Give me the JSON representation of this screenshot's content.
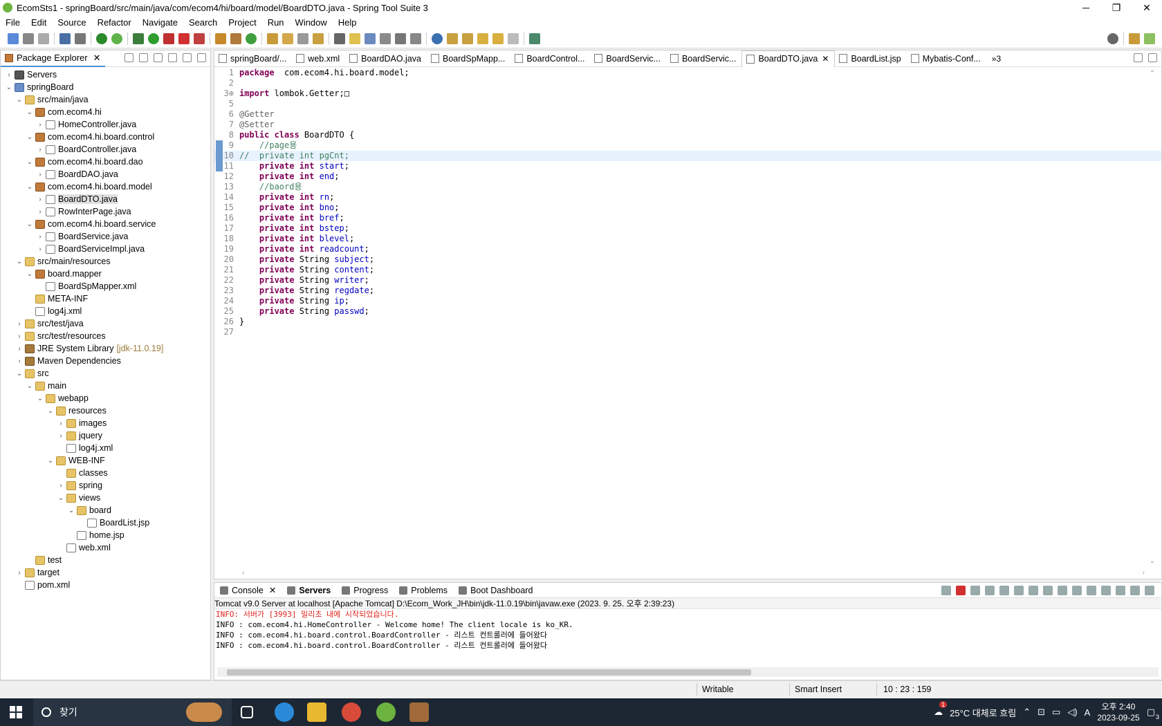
{
  "window": {
    "title": "EcomSts1 - springBoard/src/main/java/com/ecom4/hi/board/model/BoardDTO.java - Spring Tool Suite 3",
    "controls": [
      "─",
      "❐",
      "✕"
    ]
  },
  "menu": [
    "File",
    "Edit",
    "Source",
    "Refactor",
    "Navigate",
    "Search",
    "Project",
    "Run",
    "Window",
    "Help"
  ],
  "package_explorer": {
    "tab_label": "Package Explorer",
    "tree": [
      {
        "label": "Servers",
        "depth": 0,
        "arrow": "›",
        "icon": "server-folder"
      },
      {
        "label": "springBoard",
        "depth": 0,
        "arrow": "⌄",
        "icon": "project"
      },
      {
        "label": "src/main/java",
        "depth": 1,
        "arrow": "⌄",
        "icon": "source-folder"
      },
      {
        "label": "com.ecom4.hi",
        "depth": 2,
        "arrow": "⌄",
        "icon": "package"
      },
      {
        "label": "HomeController.java",
        "depth": 3,
        "arrow": "›",
        "icon": "java-file"
      },
      {
        "label": "com.ecom4.hi.board.control",
        "depth": 2,
        "arrow": "⌄",
        "icon": "package"
      },
      {
        "label": "BoardController.java",
        "depth": 3,
        "arrow": "›",
        "icon": "java-file"
      },
      {
        "label": "com.ecom4.hi.board.dao",
        "depth": 2,
        "arrow": "⌄",
        "icon": "package"
      },
      {
        "label": "BoardDAO.java",
        "depth": 3,
        "arrow": "›",
        "icon": "java-file"
      },
      {
        "label": "com.ecom4.hi.board.model",
        "depth": 2,
        "arrow": "⌄",
        "icon": "package"
      },
      {
        "label": "BoardDTO.java",
        "depth": 3,
        "arrow": "›",
        "icon": "java-file",
        "selected": true
      },
      {
        "label": "RowInterPage.java",
        "depth": 3,
        "arrow": "›",
        "icon": "java-file"
      },
      {
        "label": "com.ecom4.hi.board.service",
        "depth": 2,
        "arrow": "⌄",
        "icon": "package"
      },
      {
        "label": "BoardService.java",
        "depth": 3,
        "arrow": "›",
        "icon": "java-file"
      },
      {
        "label": "BoardServiceImpl.java",
        "depth": 3,
        "arrow": "›",
        "icon": "java-file"
      },
      {
        "label": "src/main/resources",
        "depth": 1,
        "arrow": "⌄",
        "icon": "source-folder"
      },
      {
        "label": "board.mapper",
        "depth": 2,
        "arrow": "⌄",
        "icon": "package"
      },
      {
        "label": "BoardSpMapper.xml",
        "depth": 3,
        "arrow": "",
        "icon": "xml-file"
      },
      {
        "label": "META-INF",
        "depth": 2,
        "arrow": "",
        "icon": "folder"
      },
      {
        "label": "log4j.xml",
        "depth": 2,
        "arrow": "",
        "icon": "xml-file"
      },
      {
        "label": "src/test/java",
        "depth": 1,
        "arrow": "›",
        "icon": "source-folder"
      },
      {
        "label": "src/test/resources",
        "depth": 1,
        "arrow": "›",
        "icon": "source-folder"
      },
      {
        "label": "JRE System Library",
        "depth": 1,
        "arrow": "›",
        "icon": "library",
        "suffix": "[jdk-11.0.19]"
      },
      {
        "label": "Maven Dependencies",
        "depth": 1,
        "arrow": "›",
        "icon": "library"
      },
      {
        "label": "src",
        "depth": 1,
        "arrow": "⌄",
        "icon": "source-folder"
      },
      {
        "label": "main",
        "depth": 2,
        "arrow": "⌄",
        "icon": "folder"
      },
      {
        "label": "webapp",
        "depth": 3,
        "arrow": "⌄",
        "icon": "folder"
      },
      {
        "label": "resources",
        "depth": 4,
        "arrow": "⌄",
        "icon": "folder"
      },
      {
        "label": "images",
        "depth": 5,
        "arrow": "›",
        "icon": "folder"
      },
      {
        "label": "jquery",
        "depth": 5,
        "arrow": "›",
        "icon": "folder"
      },
      {
        "label": "log4j.xml",
        "depth": 5,
        "arrow": "",
        "icon": "xml-file"
      },
      {
        "label": "WEB-INF",
        "depth": 4,
        "arrow": "⌄",
        "icon": "folder"
      },
      {
        "label": "classes",
        "depth": 5,
        "arrow": "",
        "icon": "folder"
      },
      {
        "label": "spring",
        "depth": 5,
        "arrow": "›",
        "icon": "folder"
      },
      {
        "label": "views",
        "depth": 5,
        "arrow": "⌄",
        "icon": "folder"
      },
      {
        "label": "board",
        "depth": 6,
        "arrow": "⌄",
        "icon": "folder"
      },
      {
        "label": "BoardList.jsp",
        "depth": 7,
        "arrow": "",
        "icon": "java-file"
      },
      {
        "label": "home.jsp",
        "depth": 6,
        "arrow": "",
        "icon": "java-file"
      },
      {
        "label": "web.xml",
        "depth": 5,
        "arrow": "",
        "icon": "xml-file"
      },
      {
        "label": "test",
        "depth": 2,
        "arrow": "",
        "icon": "folder"
      },
      {
        "label": "target",
        "depth": 1,
        "arrow": "›",
        "icon": "folder"
      },
      {
        "label": "pom.xml",
        "depth": 1,
        "arrow": "",
        "icon": "xml-file"
      }
    ]
  },
  "editor": {
    "tabs": [
      {
        "label": "springBoard/..."
      },
      {
        "label": "web.xml"
      },
      {
        "label": "BoardDAO.java"
      },
      {
        "label": "BoardSpMapp..."
      },
      {
        "label": "BoardControl..."
      },
      {
        "label": "BoardServic..."
      },
      {
        "label": "BoardServic..."
      },
      {
        "label": "BoardDTO.java",
        "active": true
      },
      {
        "label": "BoardList.jsp"
      },
      {
        "label": "Mybatis-Conf..."
      }
    ],
    "overflow_label": "»3",
    "current_line": 10,
    "lines": [
      {
        "n": "1",
        "parts": [
          [
            "kw",
            "package"
          ],
          [
            "",
            "  com.ecom4.hi.board.model;"
          ]
        ]
      },
      {
        "n": "2",
        "parts": []
      },
      {
        "n": "3⊕",
        "parts": [
          [
            "kw",
            "import"
          ],
          [
            "",
            " lombok.Getter;□"
          ]
        ]
      },
      {
        "n": "5",
        "parts": []
      },
      {
        "n": "6",
        "parts": [
          [
            "an",
            "@Getter"
          ]
        ]
      },
      {
        "n": "7",
        "parts": [
          [
            "an",
            "@Setter"
          ]
        ]
      },
      {
        "n": "8",
        "parts": [
          [
            "kw",
            "public class"
          ],
          [
            "",
            " BoardDTO {"
          ]
        ]
      },
      {
        "n": "9",
        "parts": [
          [
            "cm",
            "    //page용"
          ]
        ]
      },
      {
        "n": "10",
        "parts": [
          [
            "cm",
            "//  private int pgCnt;"
          ]
        ]
      },
      {
        "n": "11",
        "parts": [
          [
            "kw",
            "    private int"
          ],
          [
            "fld",
            " start"
          ],
          [
            "",
            ";"
          ]
        ]
      },
      {
        "n": "12",
        "parts": [
          [
            "kw",
            "    private int"
          ],
          [
            "fld",
            " end"
          ],
          [
            "",
            ";"
          ]
        ]
      },
      {
        "n": "13",
        "parts": [
          [
            "cm",
            "    //baord용"
          ]
        ]
      },
      {
        "n": "14",
        "parts": [
          [
            "kw",
            "    private int"
          ],
          [
            "fld",
            " rn"
          ],
          [
            "",
            ";"
          ]
        ]
      },
      {
        "n": "15",
        "parts": [
          [
            "kw",
            "    private int"
          ],
          [
            "fld",
            " bno"
          ],
          [
            "",
            ";"
          ]
        ]
      },
      {
        "n": "16",
        "parts": [
          [
            "kw",
            "    private int"
          ],
          [
            "fld",
            " bref"
          ],
          [
            "",
            ";"
          ]
        ]
      },
      {
        "n": "17",
        "parts": [
          [
            "kw",
            "    private int"
          ],
          [
            "fld",
            " bstep"
          ],
          [
            "",
            ";"
          ]
        ]
      },
      {
        "n": "18",
        "parts": [
          [
            "kw",
            "    private int"
          ],
          [
            "fld",
            " blevel"
          ],
          [
            "",
            ";"
          ]
        ]
      },
      {
        "n": "19",
        "parts": [
          [
            "kw",
            "    private int"
          ],
          [
            "fld",
            " readcount"
          ],
          [
            "",
            ";"
          ]
        ]
      },
      {
        "n": "20",
        "parts": [
          [
            "kw",
            "    private"
          ],
          [
            "",
            " String"
          ],
          [
            "fld",
            " subject"
          ],
          [
            "",
            ";"
          ]
        ]
      },
      {
        "n": "21",
        "parts": [
          [
            "kw",
            "    private"
          ],
          [
            "",
            " String"
          ],
          [
            "fld",
            " content"
          ],
          [
            "",
            ";"
          ]
        ]
      },
      {
        "n": "22",
        "parts": [
          [
            "kw",
            "    private"
          ],
          [
            "",
            " String"
          ],
          [
            "fld",
            " writer"
          ],
          [
            "",
            ";"
          ]
        ]
      },
      {
        "n": "23",
        "parts": [
          [
            "kw",
            "    private"
          ],
          [
            "",
            " String"
          ],
          [
            "fld",
            " regdate"
          ],
          [
            "",
            ";"
          ]
        ]
      },
      {
        "n": "24",
        "parts": [
          [
            "kw",
            "    private"
          ],
          [
            "",
            " String"
          ],
          [
            "fld",
            " ip"
          ],
          [
            "",
            ";"
          ]
        ]
      },
      {
        "n": "25",
        "parts": [
          [
            "kw",
            "    private"
          ],
          [
            "",
            " String"
          ],
          [
            "fld",
            " passwd"
          ],
          [
            "",
            ";"
          ]
        ]
      },
      {
        "n": "26",
        "parts": [
          [
            "",
            "}"
          ]
        ]
      },
      {
        "n": "27",
        "parts": []
      }
    ]
  },
  "console": {
    "tabs": [
      "Console",
      "Servers",
      "Progress",
      "Problems",
      "Boot Dashboard"
    ],
    "header": "Tomcat v9.0 Server at localhost [Apache Tomcat] D:\\Ecom_Work_JH\\bin\\jdk-11.0.19\\bin\\javaw.exe  (2023. 9. 25. 오후 2:39:23)",
    "lines": [
      {
        "text": "INFO: 서버가 [3993] 밀리초 내에 시작되었습니다.",
        "err": true
      },
      {
        "text": "INFO : com.ecom4.hi.HomeController - Welcome home! The client locale is ko_KR.",
        "err": false
      },
      {
        "text": "INFO : com.ecom4.hi.board.control.BoardController - 리스트 컨트롤러에 들어왔다",
        "err": false
      },
      {
        "text": "INFO : com.ecom4.hi.board.control.BoardController - 리스트 컨트롤러에 들어왔다",
        "err": false
      }
    ]
  },
  "status": {
    "writable": "Writable",
    "insert_mode": "Smart Insert",
    "position": "10 : 23 : 159"
  },
  "taskbar": {
    "search_placeholder": "찾기",
    "weather": "25°C  대체로 흐림",
    "weather_badge": "1",
    "ime": "A",
    "time": "오후 2:40",
    "date": "2023-09-25",
    "notification_count": "3"
  }
}
